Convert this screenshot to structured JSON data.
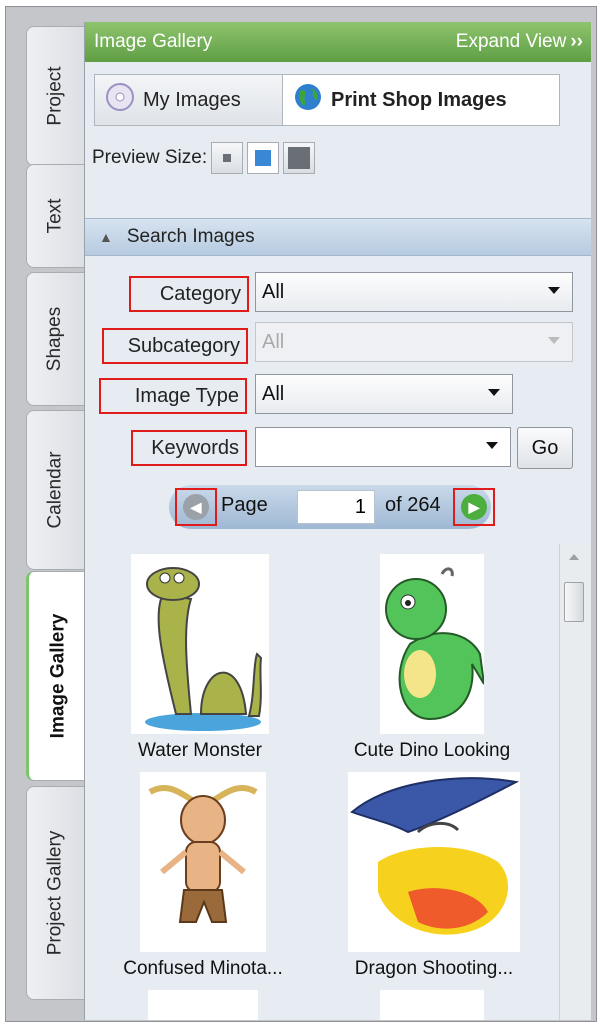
{
  "tabs": [
    {
      "label": "Project",
      "active": false
    },
    {
      "label": "Text",
      "active": false
    },
    {
      "label": "Shapes",
      "active": false
    },
    {
      "label": "Calendar",
      "active": false
    },
    {
      "label": "Image Gallery",
      "active": true
    },
    {
      "label": "Project Gallery",
      "active": false
    }
  ],
  "header": {
    "title": "Image Gallery",
    "expand_label": "Expand View",
    "expand_icon": "double-chevron-right-icon"
  },
  "source": {
    "my_images": "My Images",
    "print_shop_images": "Print Shop Images",
    "selected": "Print Shop Images"
  },
  "preview": {
    "label": "Preview Size:",
    "options": [
      "small",
      "medium",
      "large"
    ],
    "selected": "medium"
  },
  "search": {
    "section_title": "Search Images",
    "category_label": "Category",
    "category_value": "All",
    "subcategory_label": "Subcategory",
    "subcategory_value": "All",
    "image_type_label": "Image Type",
    "image_type_value": "All",
    "keywords_label": "Keywords",
    "keywords_value": "",
    "go_label": "Go"
  },
  "pager": {
    "page_label": "Page",
    "current": "1",
    "of_label": "of 264"
  },
  "images": [
    {
      "caption": "Water Monster"
    },
    {
      "caption": "Cute Dino Looking"
    },
    {
      "caption": "Confused Minota..."
    },
    {
      "caption": "Dragon Shooting..."
    }
  ],
  "colors": {
    "header_green": "#5f9e44",
    "highlight_red": "#e01b1b",
    "search_blue": "#b6cbe0"
  }
}
